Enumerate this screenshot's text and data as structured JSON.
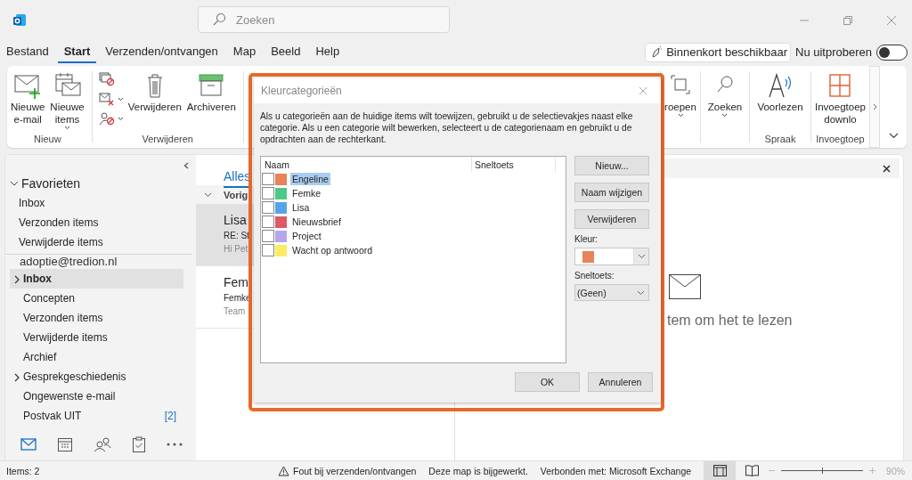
{
  "window": {
    "search_placeholder": "Zoeken"
  },
  "menu_tabs": [
    {
      "label": "Bestand",
      "selected": false
    },
    {
      "label": "Start",
      "selected": true
    },
    {
      "label": "Verzenden/ontvangen",
      "selected": false
    },
    {
      "label": "Map",
      "selected": false
    },
    {
      "label": "Beeld",
      "selected": false
    },
    {
      "label": "Help",
      "selected": false
    }
  ],
  "coming_soon": "Binnenkort beschikbaar",
  "try_now": {
    "label": "Nu uitproberen",
    "on": false
  },
  "ribbon_left": [
    {
      "label": "Nieuw",
      "buttons": [
        {
          "kind": "mail-new",
          "lines": [
            "Nieuwe",
            "e-mail"
          ],
          "dropdown": false
        },
        {
          "kind": "items-new",
          "lines": [
            "Nieuwe",
            "items"
          ],
          "dropdown": true
        }
      ]
    },
    {
      "label": "Verwijderen",
      "small_icons": [
        {
          "kind": "ignore",
          "dropdown": false
        },
        {
          "kind": "cleanup",
          "dropdown": true
        },
        {
          "kind": "junk",
          "dropdown": true
        }
      ],
      "buttons": [
        {
          "kind": "trash",
          "lines": [
            "Verwijderen"
          ],
          "dropdown": false
        },
        {
          "kind": "archive",
          "lines": [
            "Archiveren"
          ],
          "dropdown": false
        }
      ]
    }
  ],
  "ribbon_right": [
    {
      "buttons": [
        {
          "kind": "groups",
          "lines": [
            "roepen"
          ],
          "dropdown": true
        }
      ]
    },
    {
      "buttons": [
        {
          "kind": "search",
          "lines": [
            "Zoeken"
          ],
          "dropdown": true
        }
      ]
    },
    {
      "label": "Spraak",
      "buttons": [
        {
          "kind": "read-aloud",
          "lines": [
            "Voorlezen"
          ],
          "dropdown": false
        }
      ]
    },
    {
      "label": "Invoegtoep",
      "buttons": [
        {
          "kind": "addins",
          "lines": [
            "Invoegtoep",
            "downlo"
          ],
          "dropdown": false
        }
      ]
    }
  ],
  "nav": {
    "favorites": {
      "label": "Favorieten",
      "expanded": true,
      "items": [
        "Inbox",
        "Verzonden items",
        "Verwijderde items"
      ]
    },
    "account": "adoptie@tredion.nl",
    "folders": [
      {
        "label": "Inbox",
        "selected": true,
        "expandable": true
      },
      {
        "label": "Concepten",
        "selected": false,
        "expandable": false
      },
      {
        "label": "Verzonden items",
        "selected": false,
        "expandable": false
      },
      {
        "label": "Verwijderde items",
        "selected": false,
        "expandable": false
      },
      {
        "label": "Archief",
        "selected": false,
        "expandable": false
      },
      {
        "label": "Gesprekgeschiedenis",
        "selected": false,
        "expandable": true
      },
      {
        "label": "Ongewenste e-mail",
        "selected": false,
        "expandable": false
      },
      {
        "label": "Postvak UIT",
        "selected": false,
        "expandable": false,
        "count": "[2]"
      }
    ],
    "modules": [
      {
        "kind": "mail",
        "selected": true
      },
      {
        "kind": "calendar",
        "selected": false
      },
      {
        "kind": "people",
        "selected": false
      },
      {
        "kind": "tasks",
        "selected": false
      },
      {
        "kind": "more",
        "selected": false
      }
    ]
  },
  "mail_list": {
    "tab": {
      "label": "Alles",
      "selected": true
    },
    "group": "Vorig",
    "items": [
      {
        "sender": "Lisa",
        "subject": "RE: St",
        "preview": "Hi Pet",
        "selected": true
      },
      {
        "sender": "Fem",
        "subject": "Femke",
        "preview": "Team",
        "selected": false
      }
    ]
  },
  "reading_pane": {
    "message": "tem om het te lezen"
  },
  "dialog": {
    "title": "Kleurcategorieën",
    "description": "Als u categorieën aan de huidige items wilt toewijzen, gebruikt u de selectievakjes naast elke categorie. Als u een categorie wilt bewerken, selecteert u de categorienaam en gebruikt u de opdrachten aan de rechterkant.",
    "columns": [
      "Naam",
      "Sneltoets"
    ],
    "categories": [
      {
        "name": "Engeline",
        "color": "#e8825a",
        "checked": false,
        "selected": true
      },
      {
        "name": "Femke",
        "color": "#4cc888",
        "checked": false,
        "selected": false
      },
      {
        "name": "Lisa",
        "color": "#56a4e8",
        "checked": false,
        "selected": false
      },
      {
        "name": "Nieuwsbrief",
        "color": "#dc5a68",
        "checked": false,
        "selected": false
      },
      {
        "name": "Project",
        "color": "#b4a6ec",
        "checked": false,
        "selected": false
      },
      {
        "name": "Wacht op antwoord",
        "color": "#fcec62",
        "checked": false,
        "selected": false
      }
    ],
    "side_buttons": [
      "Nieuw...",
      "Naam wijzigen",
      "Verwijderen"
    ],
    "color_label": "Kleur:",
    "shortcut_label": "Sneltoets:",
    "shortcut_value": "(Geen)",
    "buttons": [
      "OK",
      "Annuleren"
    ]
  },
  "status_bar": {
    "items": "Items: 2",
    "error": "Fout bij verzenden/ontvangen",
    "folder": "Deze map is bijgewerkt.",
    "connection": "Verbonden met: Microsoft Exchange",
    "views": [
      {
        "kind": "normal",
        "selected": true
      },
      {
        "kind": "reading",
        "selected": false
      }
    ],
    "zoom": {
      "level": 0.5,
      "label": "90%"
    }
  }
}
